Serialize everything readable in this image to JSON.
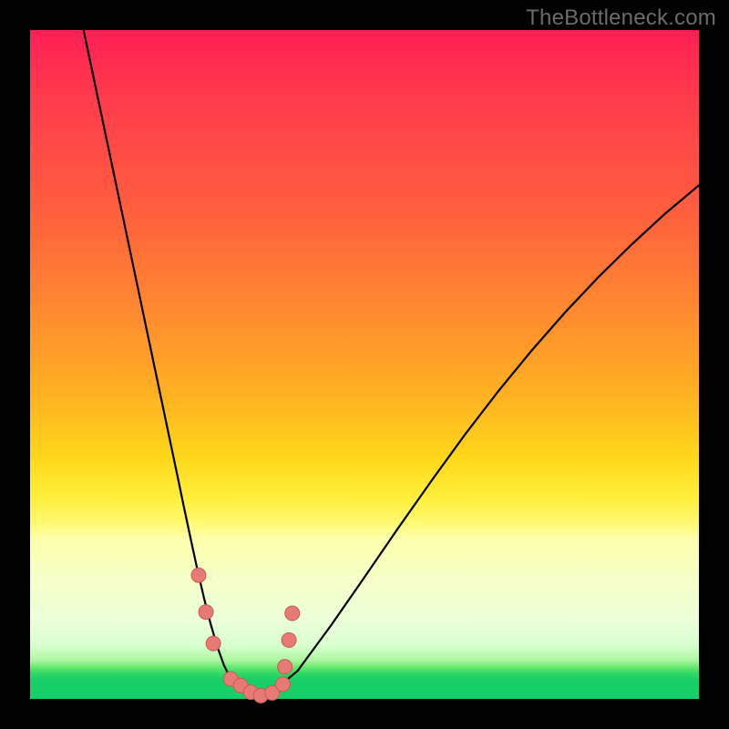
{
  "watermark": "TheBottleneck.com",
  "colors": {
    "curve": "#000000",
    "marker_fill": "#e77a74",
    "marker_stroke": "#c95a54",
    "frame": "#000000"
  },
  "chart_data": {
    "type": "line",
    "title": "",
    "xlabel": "",
    "ylabel": "",
    "xlim": [
      0,
      100
    ],
    "ylim": [
      0,
      100
    ],
    "grid": false,
    "legend": false,
    "series": [
      {
        "name": "bottleneck-curve",
        "x": [
          8.0,
          10.0,
          12.0,
          14.0,
          16.0,
          18.0,
          20.0,
          22.0,
          23.0,
          24.0,
          25.0,
          26.0,
          27.0,
          28.0,
          29.0,
          30.0,
          32.0,
          34.0,
          36.0,
          40.0,
          45.0,
          50.0,
          55.0,
          60.0,
          65.0,
          70.0,
          75.0,
          80.0,
          85.0,
          90.0,
          95.0,
          100.0
        ],
        "y": [
          100.0,
          90.5,
          81.0,
          71.5,
          62.0,
          52.5,
          43.0,
          33.5,
          28.7,
          24.0,
          19.4,
          15.1,
          11.2,
          7.8,
          5.0,
          3.0,
          1.2,
          0.6,
          0.9,
          4.2,
          11.0,
          18.2,
          25.5,
          32.6,
          39.5,
          46.0,
          52.1,
          57.8,
          63.1,
          68.0,
          72.6,
          76.8
        ]
      }
    ],
    "markers": [
      {
        "x": 25.2,
        "y": 18.5
      },
      {
        "x": 26.3,
        "y": 13.0
      },
      {
        "x": 27.4,
        "y": 8.3
      },
      {
        "x": 30.0,
        "y": 3.0
      },
      {
        "x": 31.5,
        "y": 2.0
      },
      {
        "x": 33.0,
        "y": 1.0
      },
      {
        "x": 34.5,
        "y": 0.5
      },
      {
        "x": 36.2,
        "y": 0.9
      },
      {
        "x": 37.8,
        "y": 2.2
      },
      {
        "x": 38.1,
        "y": 4.8
      },
      {
        "x": 38.7,
        "y": 8.8
      },
      {
        "x": 39.2,
        "y": 12.8
      }
    ],
    "marker_radius": 8
  }
}
